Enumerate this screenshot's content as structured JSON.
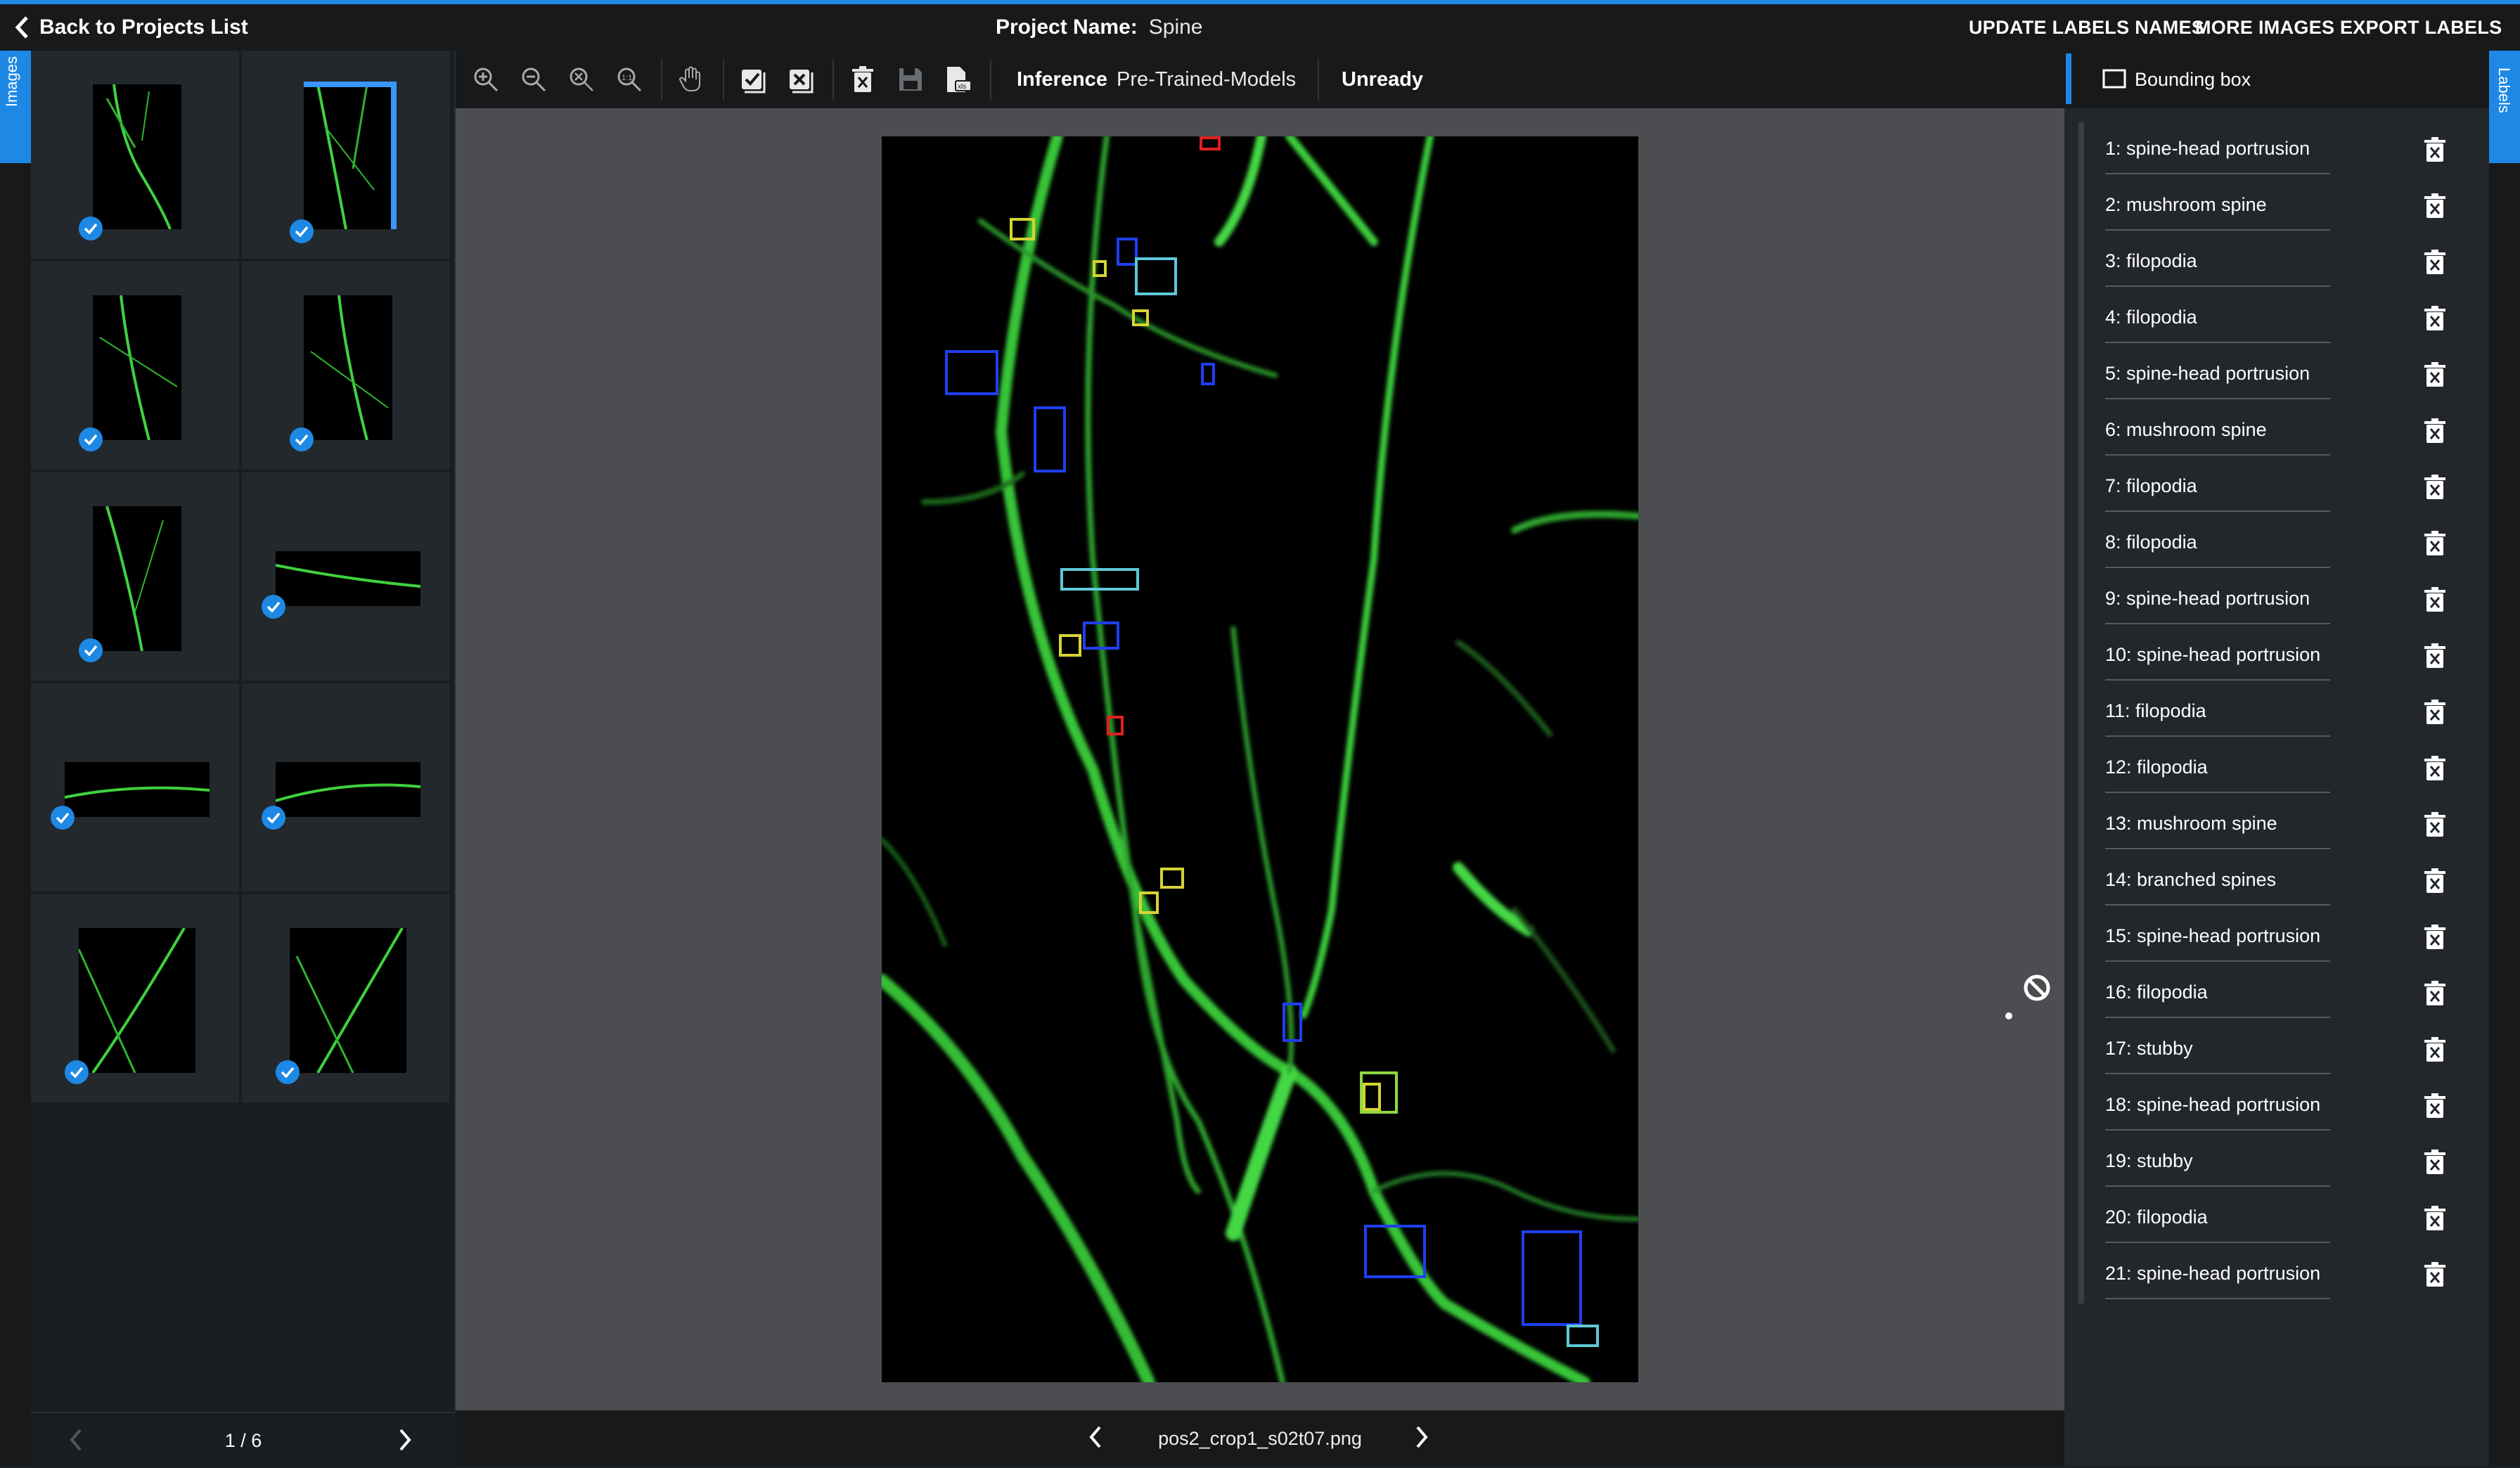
{
  "header": {
    "back_label": "Back to Projects List",
    "project_label": "Project Name:",
    "project_name": "Spine",
    "buttons": [
      "UPDATE LABELS NAMES",
      "MORE IMAGES",
      "EXPORT LABELS"
    ]
  },
  "side_tabs": {
    "left": "Images",
    "right": "Labels"
  },
  "gallery": {
    "page_indicator": "1 / 6",
    "thumbnails": [
      {
        "orientation": "portrait",
        "checked": true,
        "selected": false
      },
      {
        "orientation": "portrait",
        "checked": true,
        "selected": true
      },
      {
        "orientation": "portrait",
        "checked": true,
        "selected": false
      },
      {
        "orientation": "portrait",
        "checked": true,
        "selected": false
      },
      {
        "orientation": "portrait",
        "checked": true,
        "selected": false
      },
      {
        "orientation": "landscape",
        "checked": true,
        "selected": false
      },
      {
        "orientation": "landscape",
        "checked": true,
        "selected": false
      },
      {
        "orientation": "landscape",
        "checked": true,
        "selected": false
      },
      {
        "orientation": "portrait",
        "checked": true,
        "selected": false
      },
      {
        "orientation": "portrait",
        "checked": true,
        "selected": false
      }
    ]
  },
  "toolbar": {
    "tools": [
      "zoom-in-icon",
      "zoom-out-icon",
      "zoom-fit-icon",
      "zoom-actual-icon",
      "pan-hand-icon",
      "check-icon",
      "uncheck-icon",
      "delete-icon",
      "save-icon",
      "file-icon"
    ],
    "inference_label": "Inference",
    "models_label": "Pre-Trained-Models",
    "status_label": "Unready"
  },
  "viewer": {
    "filename": "pos2_crop1_s02t07.png"
  },
  "colors": {
    "accent": "#1e88e5",
    "yellow_box": "#d6d332",
    "blue_box": "#1f3ff0",
    "cyan_box": "#5fc9d8",
    "red_box": "#e02020",
    "lime_box": "#8fd840"
  },
  "labels_panel": {
    "tool_label": "Bounding box",
    "labels": [
      "1: spine-head portrusion",
      "2: mushroom spine",
      "3: filopodia",
      "4: filopodia",
      "5: spine-head portrusion",
      "6: mushroom spine",
      "7: filopodia",
      "8: filopodia",
      "9: spine-head portrusion",
      "10: spine-head portrusion",
      "11: filopodia",
      "12: filopodia",
      "13: mushroom spine",
      "14: branched spines",
      "15: spine-head portrusion",
      "16: filopodia",
      "17: stubby",
      "18: spine-head portrusion",
      "19: stubby",
      "20: filopodia",
      "21: spine-head portrusion"
    ]
  }
}
